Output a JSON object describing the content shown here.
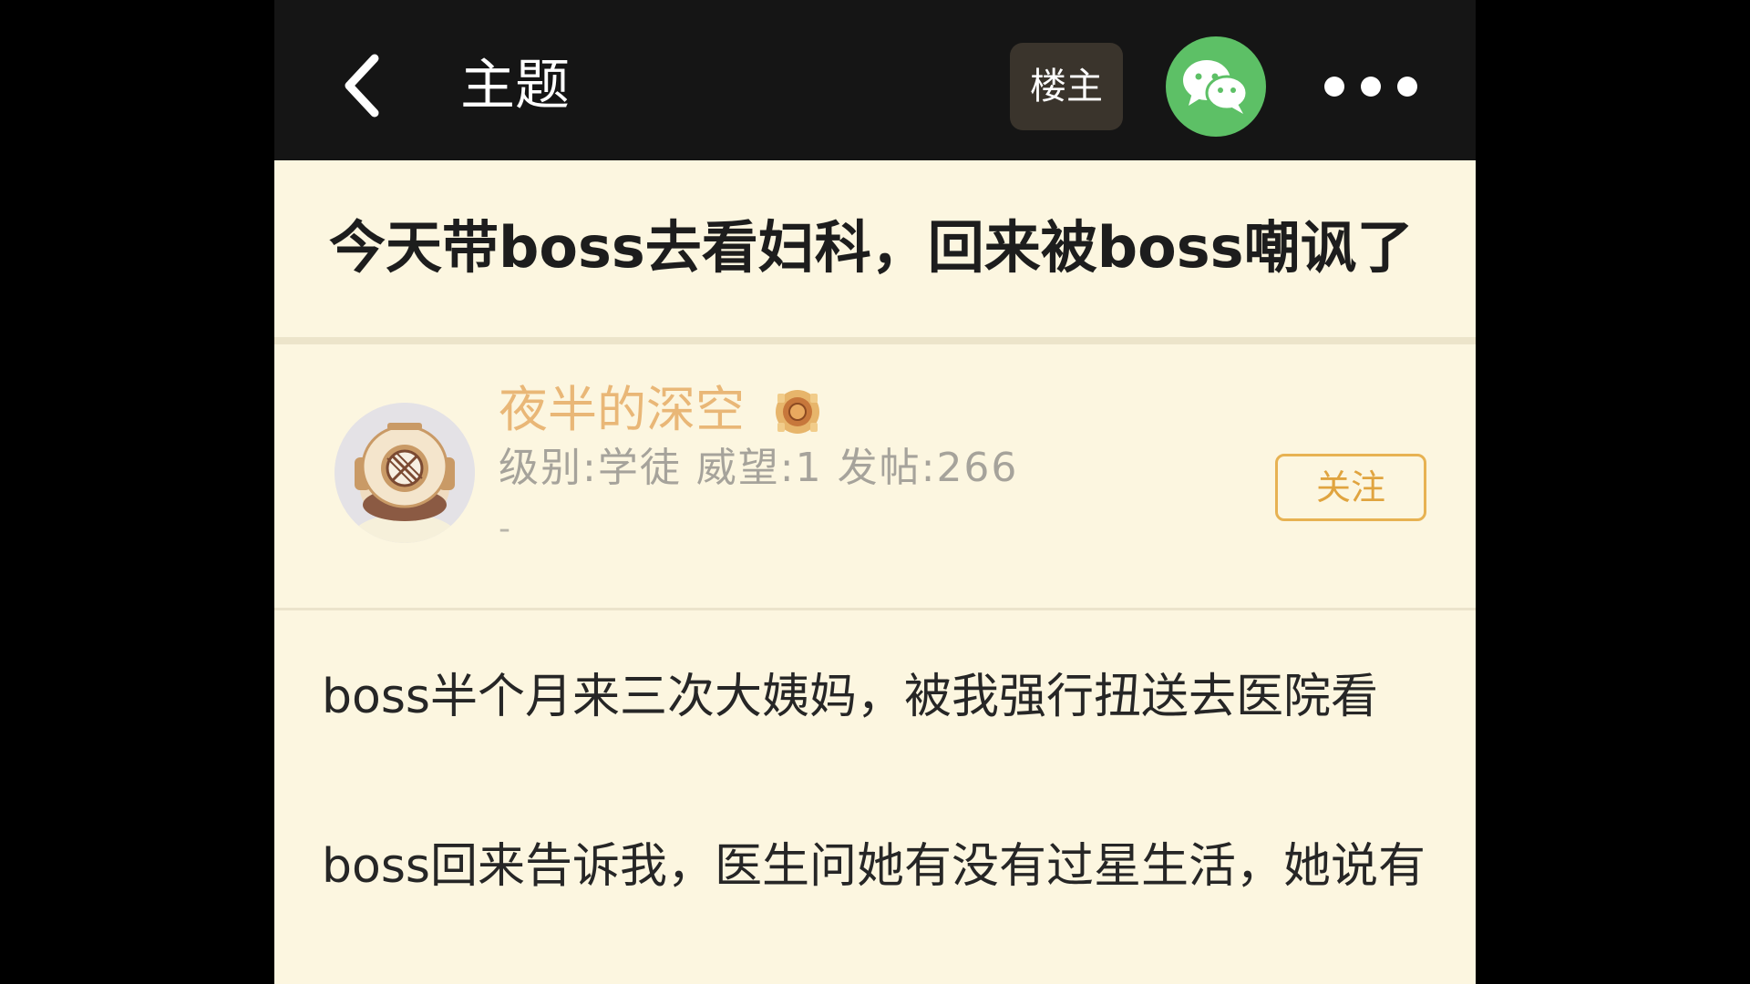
{
  "header": {
    "title": "主题",
    "op_button_label": "楼主",
    "share_icon": "wechat-icon",
    "back_icon": "chevron-left-icon",
    "more_icon": "more-dots-icon"
  },
  "post": {
    "title": "今天带boss去看妇科，回来被boss嘲讽了",
    "paragraphs": [
      "boss半个月来三次大姨妈，被我强行扭送去医院看",
      "boss回来告诉我，医生问她有没有过星生活，她说有"
    ]
  },
  "author": {
    "name": "夜半的深空",
    "meta": "级别:学徒 威望:1 发帖:266",
    "signature": "-",
    "follow_label": "关注",
    "avatar_icon": "diving-helmet-avatar",
    "badge_icon": "medal-icon"
  },
  "colors": {
    "header_bg": "#151515",
    "page_bg": "#fcf6e0",
    "author_name": "#e9b777",
    "follow_accent": "#e7b252",
    "wechat_green": "#5dc066"
  }
}
